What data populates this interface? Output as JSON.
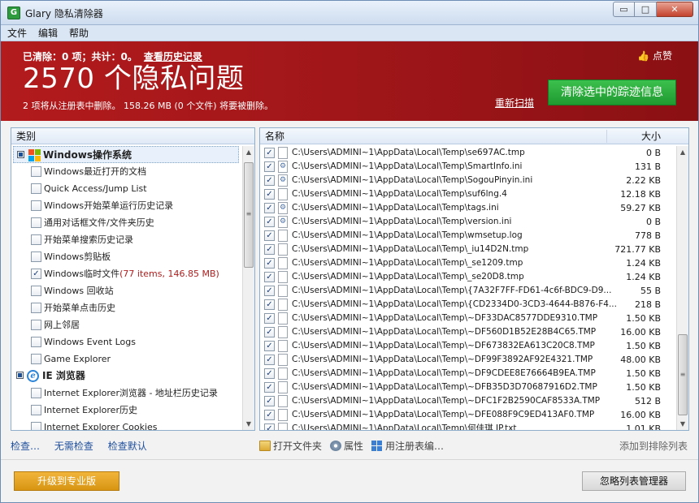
{
  "window": {
    "title": "Glary 隐私清除器",
    "icon": "app-logo-icon"
  },
  "titlebar_buttons": {
    "minimize": "▭",
    "maximize": "□",
    "close": "✕"
  },
  "menu": [
    "文件",
    "编辑",
    "帮助"
  ],
  "banner": {
    "stats": "已清除：0 项；共计：0。",
    "history_link": "查看历史记录",
    "headline": "2570 个隐私问题",
    "subline": "2 项将从注册表中删除。 158.26 MB (0 个文件) 将要被删除。",
    "like": "点赞",
    "like_icon": "thumbs-up-icon",
    "rescan": "重新扫描",
    "clean_button": "清除选中的踪迹信息",
    "colors": {
      "banner": "#a3171a",
      "clean_button": "#2aa83b"
    }
  },
  "left_panel": {
    "header": "类别",
    "groups": [
      {
        "name": "Windows操作系统",
        "icon": "windows-logo-icon"
      },
      {
        "name": "IE 浏览器",
        "icon": "ie-logo-icon"
      }
    ],
    "items": [
      {
        "label": "Windows最近打开的文档",
        "checked": ""
      },
      {
        "label": "Quick Access/Jump List",
        "checked": ""
      },
      {
        "label": "Windows开始菜单运行历史记录",
        "checked": ""
      },
      {
        "label": "通用对话框文件/文件夹历史",
        "checked": ""
      },
      {
        "label": "开始菜单搜索历史记录",
        "checked": ""
      },
      {
        "label": "Windows剪贴板",
        "checked": ""
      },
      {
        "label": "Windows临时文件",
        "extra": "(77 items, 146.85 MB)",
        "checked": "✓"
      },
      {
        "label": "Windows 回收站",
        "checked": ""
      },
      {
        "label": "开始菜单点击历史",
        "checked": ""
      },
      {
        "label": "网上邻居",
        "checked": ""
      },
      {
        "label": "Windows Event Logs",
        "checked": ""
      },
      {
        "label": "Game Explorer",
        "checked": ""
      }
    ],
    "ie_items": [
      {
        "label": "Internet Explorer浏览器 - 地址栏历史记录",
        "checked": ""
      },
      {
        "label": "Internet Explorer历史",
        "checked": ""
      },
      {
        "label": "Internet Explorer Cookies",
        "checked": ""
      }
    ]
  },
  "right_panel": {
    "col_name": "名称",
    "col_size": "大小",
    "files": [
      {
        "path": "C:\\Users\\ADMINI~1\\AppData\\Local\\Temp\\se697AC.tmp",
        "size": "0 B",
        "icon": "file-icon"
      },
      {
        "path": "C:\\Users\\ADMINI~1\\AppData\\Local\\Temp\\SmartInfo.ini",
        "size": "131 B",
        "icon": "settings-file-icon"
      },
      {
        "path": "C:\\Users\\ADMINI~1\\AppData\\Local\\Temp\\SogouPinyin.ini",
        "size": "2.22 KB",
        "icon": "settings-file-icon"
      },
      {
        "path": "C:\\Users\\ADMINI~1\\AppData\\Local\\Temp\\suf6lng.4",
        "size": "12.18 KB",
        "icon": "file-icon"
      },
      {
        "path": "C:\\Users\\ADMINI~1\\AppData\\Local\\Temp\\tags.ini",
        "size": "59.27 KB",
        "icon": "settings-file-icon"
      },
      {
        "path": "C:\\Users\\ADMINI~1\\AppData\\Local\\Temp\\version.ini",
        "size": "0 B",
        "icon": "settings-file-icon"
      },
      {
        "path": "C:\\Users\\ADMINI~1\\AppData\\Local\\Temp\\wmsetup.log",
        "size": "778 B",
        "icon": "file-icon"
      },
      {
        "path": "C:\\Users\\ADMINI~1\\AppData\\Local\\Temp\\_iu14D2N.tmp",
        "size": "721.77 KB",
        "icon": "file-icon"
      },
      {
        "path": "C:\\Users\\ADMINI~1\\AppData\\Local\\Temp\\_se1209.tmp",
        "size": "1.24 KB",
        "icon": "file-icon"
      },
      {
        "path": "C:\\Users\\ADMINI~1\\AppData\\Local\\Temp\\_se20D8.tmp",
        "size": "1.24 KB",
        "icon": "file-icon"
      },
      {
        "path": "C:\\Users\\ADMINI~1\\AppData\\Local\\Temp\\{7A32F7FF-FD61-4c6f-BDC9-D9...",
        "size": "55 B",
        "icon": "file-icon"
      },
      {
        "path": "C:\\Users\\ADMINI~1\\AppData\\Local\\Temp\\{CD2334D0-3CD3-4644-B876-F4...",
        "size": "218 B",
        "icon": "file-icon"
      },
      {
        "path": "C:\\Users\\ADMINI~1\\AppData\\Local\\Temp\\~DF33DAC8577DDE9310.TMP",
        "size": "1.50 KB",
        "icon": "file-icon"
      },
      {
        "path": "C:\\Users\\ADMINI~1\\AppData\\Local\\Temp\\~DF560D1B52E28B4C65.TMP",
        "size": "16.00 KB",
        "icon": "file-icon"
      },
      {
        "path": "C:\\Users\\ADMINI~1\\AppData\\Local\\Temp\\~DF673832EA613C20C8.TMP",
        "size": "1.50 KB",
        "icon": "file-icon"
      },
      {
        "path": "C:\\Users\\ADMINI~1\\AppData\\Local\\Temp\\~DF99F3892AF92E4321.TMP",
        "size": "48.00 KB",
        "icon": "file-icon"
      },
      {
        "path": "C:\\Users\\ADMINI~1\\AppData\\Local\\Temp\\~DF9CDEE8E76664B9EA.TMP",
        "size": "1.50 KB",
        "icon": "file-icon"
      },
      {
        "path": "C:\\Users\\ADMINI~1\\AppData\\Local\\Temp\\~DFB35D3D70687916D2.TMP",
        "size": "1.50 KB",
        "icon": "file-icon"
      },
      {
        "path": "C:\\Users\\ADMINI~1\\AppData\\Local\\Temp\\~DFC1F2B2590CAF8533A.TMP",
        "size": "512 B",
        "icon": "file-icon"
      },
      {
        "path": "C:\\Users\\ADMINI~1\\AppData\\Local\\Temp\\~DFE088F9C9ED413AF0.TMP",
        "size": "16.00 KB",
        "icon": "file-icon"
      },
      {
        "path": "C:\\Users\\ADMINI~1\\AppData\\Local\\Temp\\何佳琪 IP.txt",
        "size": "1.01 KB",
        "icon": "file-icon"
      }
    ]
  },
  "bottom": {
    "links": [
      "检查…",
      "无需检查",
      "检查默认"
    ],
    "tools": [
      {
        "label": "打开文件夹",
        "icon": "open-folder-icon"
      },
      {
        "label": "属性",
        "icon": "properties-icon"
      },
      {
        "label": "用注册表编…",
        "icon": "regedit-icon"
      }
    ],
    "exclude": "添加到排除列表",
    "upgrade": "升级到专业版",
    "ignore_manager": "忽略列表管理器",
    "colors": {
      "upgrade": "#e3a123"
    }
  }
}
